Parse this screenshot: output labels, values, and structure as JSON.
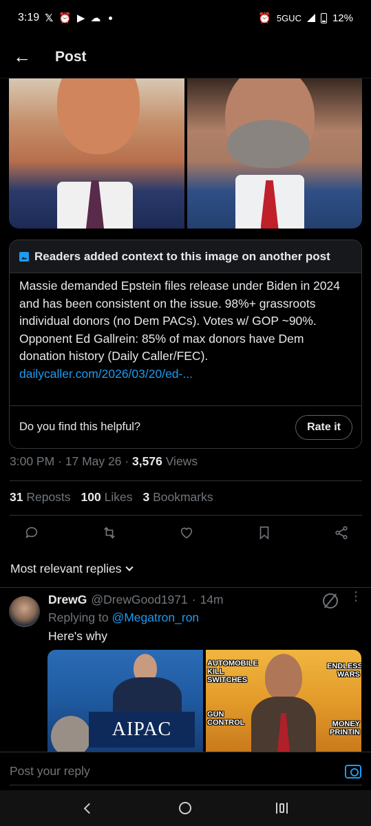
{
  "status_bar": {
    "time": "3:19",
    "network": "5GUC",
    "battery": "12%",
    "icons": [
      "x-logo-icon",
      "alarm-icon",
      "youtube-icon",
      "cloud-icon",
      "dot-icon",
      "alarm-icon",
      "signal-icon",
      "battery-icon"
    ]
  },
  "header": {
    "title": "Post",
    "back_icon": "arrow-left-icon"
  },
  "community_note": {
    "title": "Readers added context to this image on another post",
    "body": "Massie demanded Epstein files release under Biden in 2024 and has been consistent on the issue. 98%+ grassroots individual donors (no Dem PACs). Votes w/ GOP ~90%. Opponent Ed Gallrein: 85% of max donors have Dem donation history (Daily Caller/FEC).",
    "link": "dailycaller.com/2026/03/20/ed-...",
    "question": "Do you find this helpful?",
    "rate_label": "Rate it"
  },
  "meta": {
    "time": "3:00 PM",
    "date": "17 May 26",
    "views": "3,576",
    "views_label": "Views"
  },
  "stats": {
    "reposts_count": "31",
    "reposts_label": "Reposts",
    "likes_count": "100",
    "likes_label": "Likes",
    "bookmarks_count": "3",
    "bookmarks_label": "Bookmarks"
  },
  "actions": [
    "reply-icon",
    "repost-icon",
    "like-icon",
    "bookmark-icon",
    "share-icon"
  ],
  "replies_sort": "Most relevant replies",
  "reply": {
    "name": "DrewG",
    "handle": "@DrewGood1971",
    "time": "14m",
    "replying_prefix": "Replying to",
    "replying_handle": "@Megatron_ron",
    "text": "Here's why",
    "media_left_text": "AIPAC",
    "media_right_captions": [
      "AUTOMOBILE KILL SWITCHES",
      "ENDLESS WARS",
      "GUN CONTROL",
      "MONEY PRINTIN"
    ]
  },
  "composer": {
    "placeholder": "Post your reply"
  },
  "colors": {
    "accent": "#1d9bf0",
    "background": "#000000",
    "secondary_text": "#71767b"
  }
}
